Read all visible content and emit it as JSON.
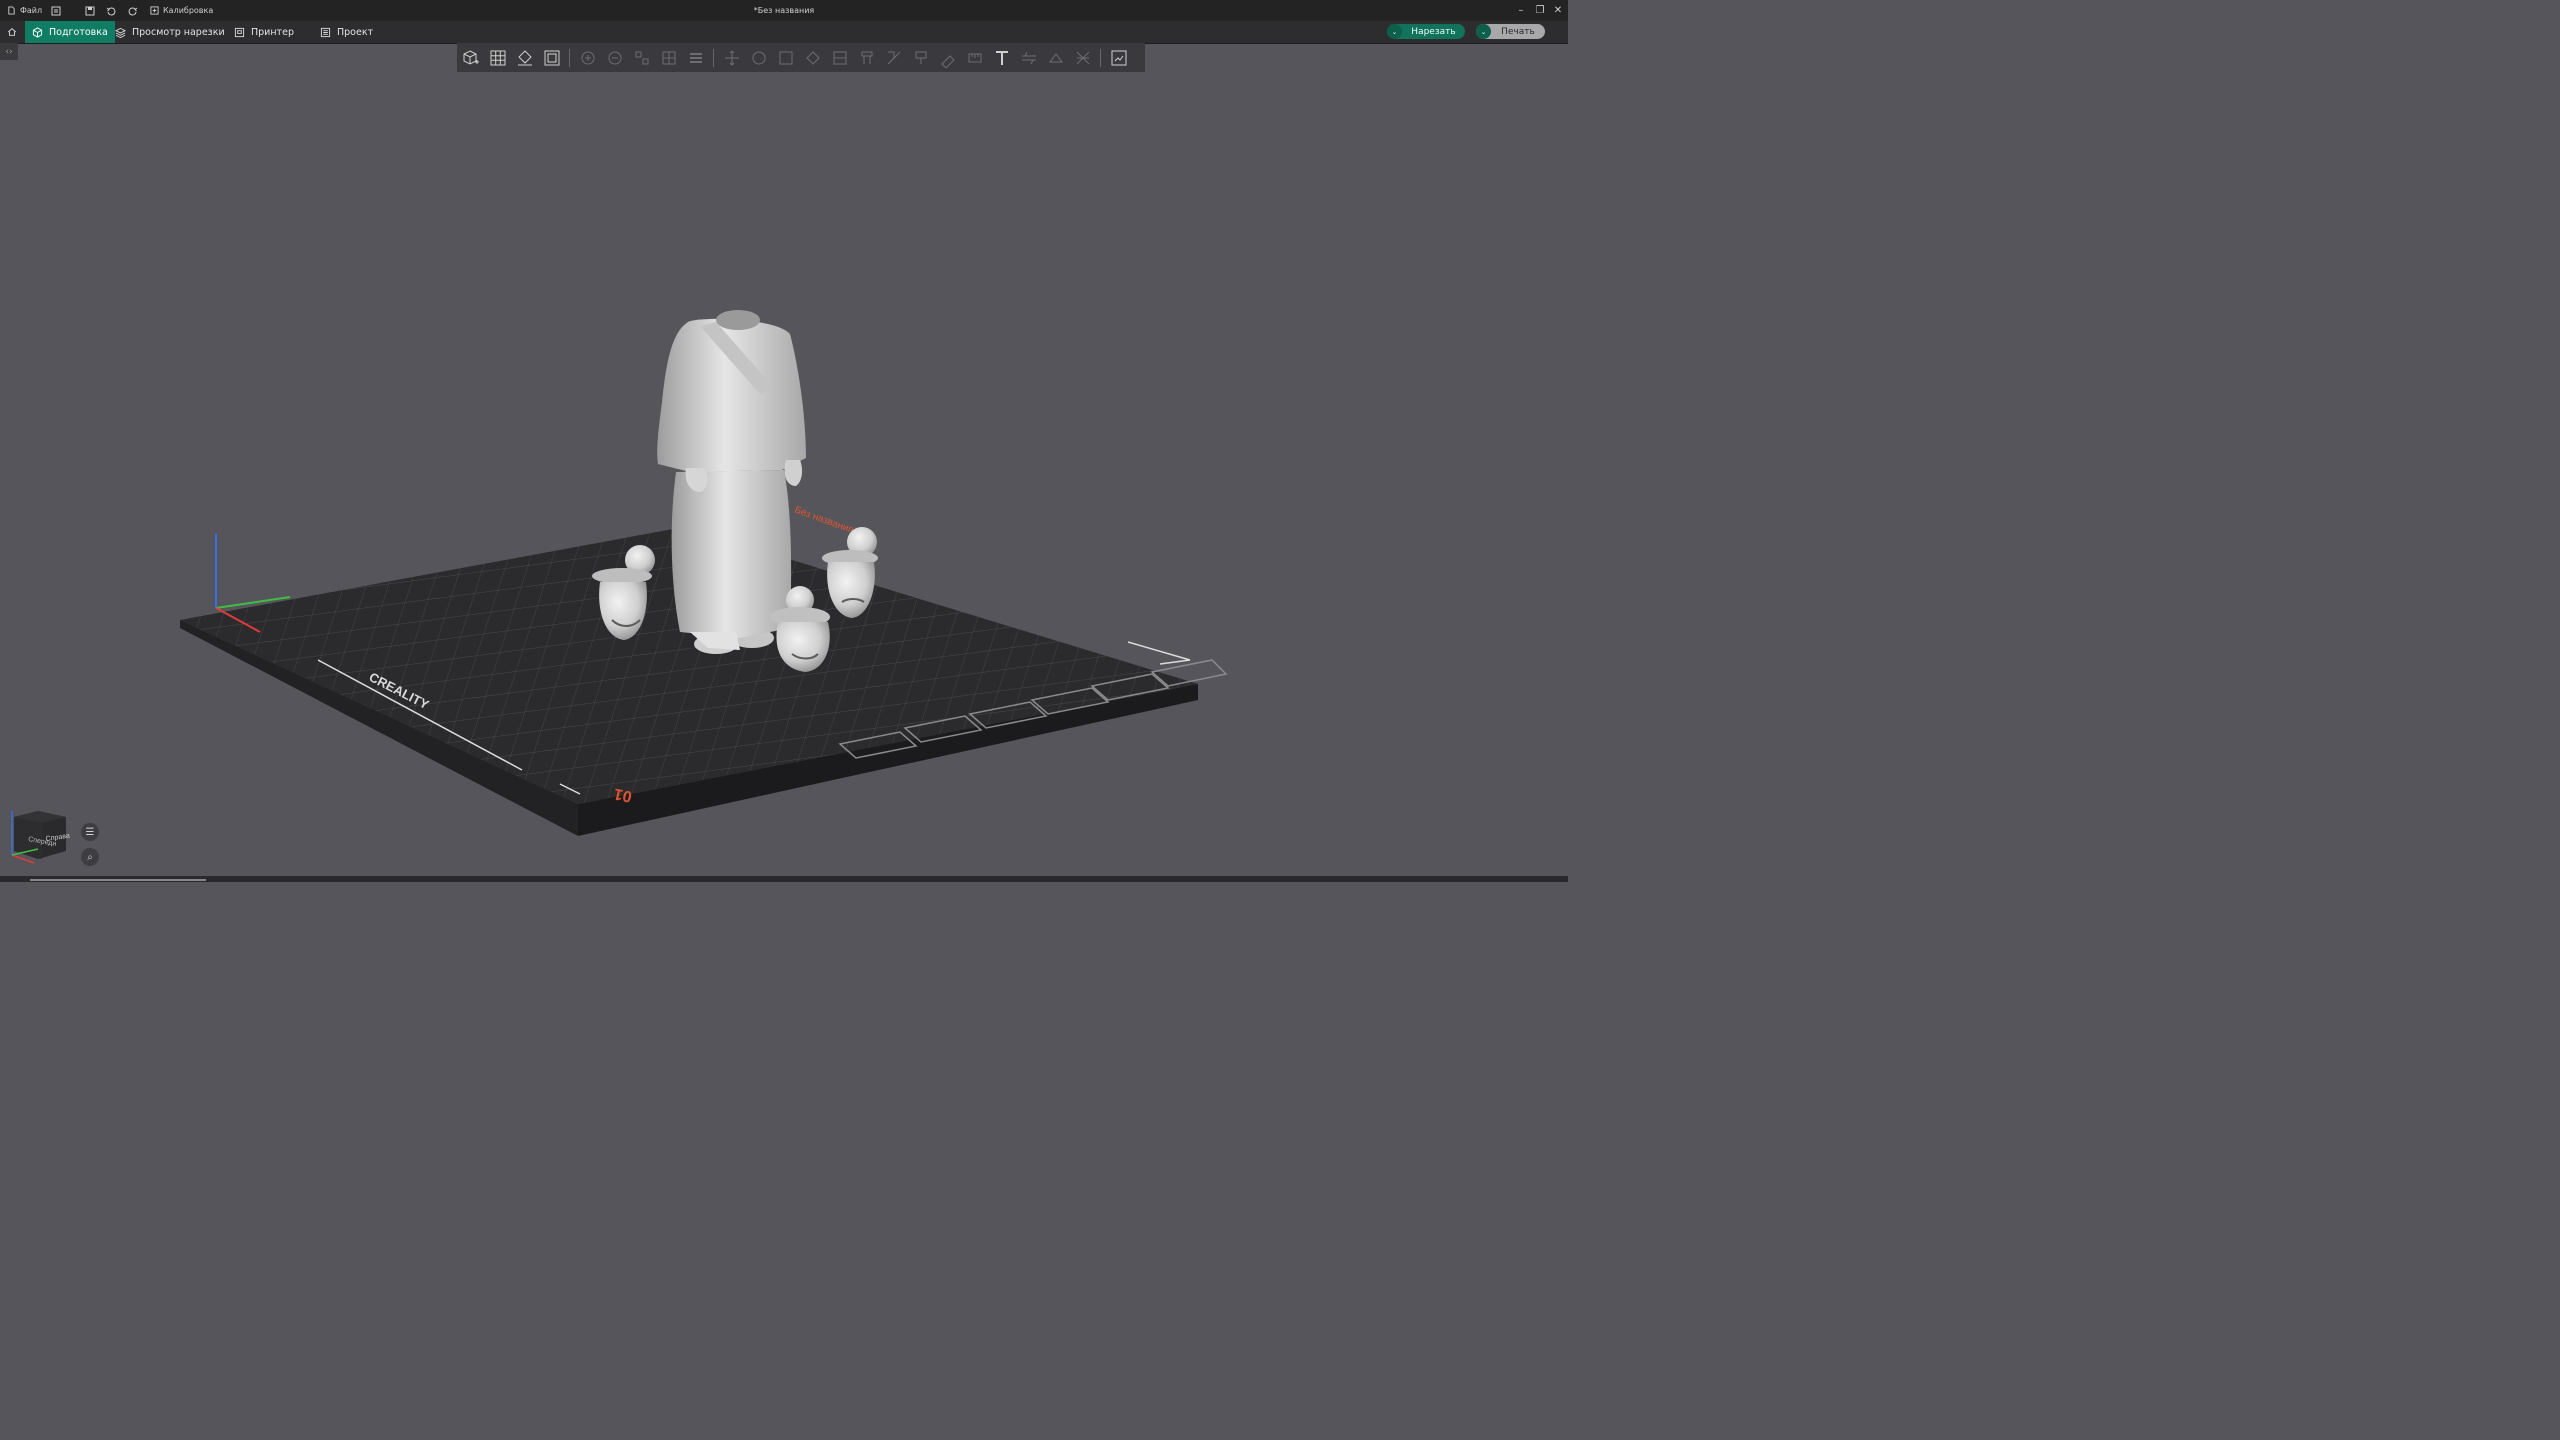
{
  "titlebar": {
    "file_label": "Файл",
    "calibration_label": "Калибровка",
    "window_title": "*Без названия"
  },
  "tabs": [
    {
      "label": "Подготовка",
      "active": true
    },
    {
      "label": "Просмотр нарезки",
      "active": false
    },
    {
      "label": "Принтер",
      "active": false
    },
    {
      "label": "Проект",
      "active": false
    }
  ],
  "actions": {
    "slice_label": "Нарезать",
    "print_label": "Печать"
  },
  "scene": {
    "plate_label": "Без названия",
    "plate_number": "01",
    "brand_text": "CREALITY"
  },
  "viewcube": {
    "left_face": "Спереди",
    "right_face": "Справа"
  },
  "colors": {
    "accent": "#0f7d63",
    "background": "#55555b",
    "plate_label": "#e0552f",
    "axis_x": "#e03a3a",
    "axis_y": "#3fbf3f",
    "axis_z": "#3a6fe0"
  }
}
